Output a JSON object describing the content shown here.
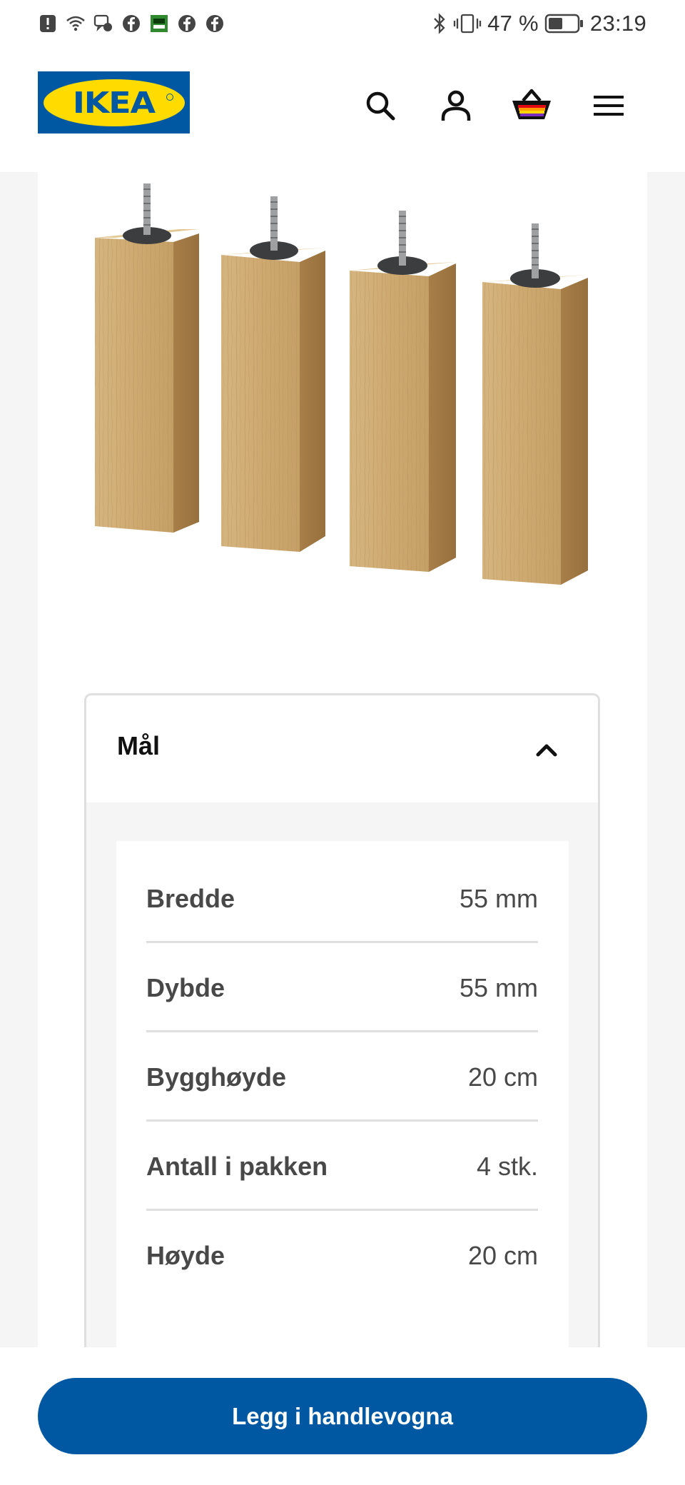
{
  "status_bar": {
    "battery_percent": "47 %",
    "time": "23:19",
    "left_icons": [
      "alert-icon",
      "wifi-icon",
      "chat-icon",
      "facebook-icon",
      "app-icon",
      "facebook-icon",
      "facebook-icon"
    ],
    "right_icons": [
      "bluetooth-icon",
      "vibrate-icon",
      "battery-icon"
    ]
  },
  "header": {
    "logo_text": "IKEA",
    "icons": [
      "search-icon",
      "user-icon",
      "shopping-basket-icon",
      "menu-icon"
    ],
    "brand_blue": "#0058a3",
    "brand_yellow": "#ffdb00"
  },
  "product": {
    "image": "four-oak-furniture-legs"
  },
  "dimensions": {
    "title": "Mål",
    "expanded": true,
    "rows": [
      {
        "label": "Bredde",
        "value": "55 mm"
      },
      {
        "label": "Dybde",
        "value": "55 mm"
      },
      {
        "label": "Bygghøyde",
        "value": "20 cm"
      },
      {
        "label": "Antall i pakken",
        "value": "4 stk."
      },
      {
        "label": "Høyde",
        "value": "20 cm"
      }
    ]
  },
  "cta": {
    "label": "Legg i handlevogna",
    "color": "#0058a3"
  }
}
